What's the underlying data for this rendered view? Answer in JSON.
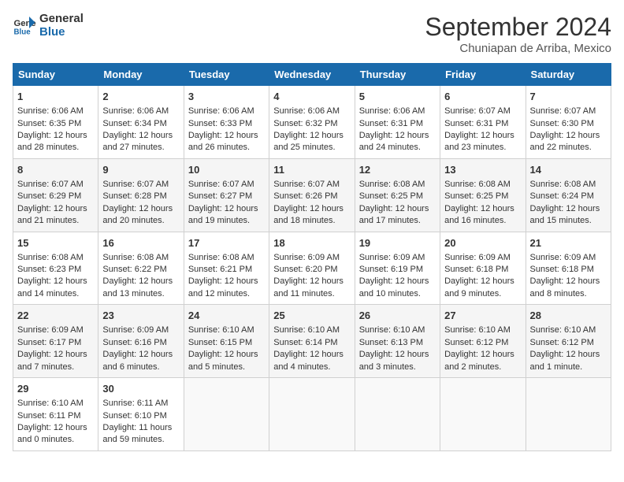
{
  "header": {
    "logo_line1": "General",
    "logo_line2": "Blue",
    "title": "September 2024",
    "subtitle": "Chuniapan de Arriba, Mexico"
  },
  "days_of_week": [
    "Sunday",
    "Monday",
    "Tuesday",
    "Wednesday",
    "Thursday",
    "Friday",
    "Saturday"
  ],
  "weeks": [
    [
      {
        "day": "1",
        "lines": [
          "Sunrise: 6:06 AM",
          "Sunset: 6:35 PM",
          "Daylight: 12 hours",
          "and 28 minutes."
        ]
      },
      {
        "day": "2",
        "lines": [
          "Sunrise: 6:06 AM",
          "Sunset: 6:34 PM",
          "Daylight: 12 hours",
          "and 27 minutes."
        ]
      },
      {
        "day": "3",
        "lines": [
          "Sunrise: 6:06 AM",
          "Sunset: 6:33 PM",
          "Daylight: 12 hours",
          "and 26 minutes."
        ]
      },
      {
        "day": "4",
        "lines": [
          "Sunrise: 6:06 AM",
          "Sunset: 6:32 PM",
          "Daylight: 12 hours",
          "and 25 minutes."
        ]
      },
      {
        "day": "5",
        "lines": [
          "Sunrise: 6:06 AM",
          "Sunset: 6:31 PM",
          "Daylight: 12 hours",
          "and 24 minutes."
        ]
      },
      {
        "day": "6",
        "lines": [
          "Sunrise: 6:07 AM",
          "Sunset: 6:31 PM",
          "Daylight: 12 hours",
          "and 23 minutes."
        ]
      },
      {
        "day": "7",
        "lines": [
          "Sunrise: 6:07 AM",
          "Sunset: 6:30 PM",
          "Daylight: 12 hours",
          "and 22 minutes."
        ]
      }
    ],
    [
      {
        "day": "8",
        "lines": [
          "Sunrise: 6:07 AM",
          "Sunset: 6:29 PM",
          "Daylight: 12 hours",
          "and 21 minutes."
        ]
      },
      {
        "day": "9",
        "lines": [
          "Sunrise: 6:07 AM",
          "Sunset: 6:28 PM",
          "Daylight: 12 hours",
          "and 20 minutes."
        ]
      },
      {
        "day": "10",
        "lines": [
          "Sunrise: 6:07 AM",
          "Sunset: 6:27 PM",
          "Daylight: 12 hours",
          "and 19 minutes."
        ]
      },
      {
        "day": "11",
        "lines": [
          "Sunrise: 6:07 AM",
          "Sunset: 6:26 PM",
          "Daylight: 12 hours",
          "and 18 minutes."
        ]
      },
      {
        "day": "12",
        "lines": [
          "Sunrise: 6:08 AM",
          "Sunset: 6:25 PM",
          "Daylight: 12 hours",
          "and 17 minutes."
        ]
      },
      {
        "day": "13",
        "lines": [
          "Sunrise: 6:08 AM",
          "Sunset: 6:25 PM",
          "Daylight: 12 hours",
          "and 16 minutes."
        ]
      },
      {
        "day": "14",
        "lines": [
          "Sunrise: 6:08 AM",
          "Sunset: 6:24 PM",
          "Daylight: 12 hours",
          "and 15 minutes."
        ]
      }
    ],
    [
      {
        "day": "15",
        "lines": [
          "Sunrise: 6:08 AM",
          "Sunset: 6:23 PM",
          "Daylight: 12 hours",
          "and 14 minutes."
        ]
      },
      {
        "day": "16",
        "lines": [
          "Sunrise: 6:08 AM",
          "Sunset: 6:22 PM",
          "Daylight: 12 hours",
          "and 13 minutes."
        ]
      },
      {
        "day": "17",
        "lines": [
          "Sunrise: 6:08 AM",
          "Sunset: 6:21 PM",
          "Daylight: 12 hours",
          "and 12 minutes."
        ]
      },
      {
        "day": "18",
        "lines": [
          "Sunrise: 6:09 AM",
          "Sunset: 6:20 PM",
          "Daylight: 12 hours",
          "and 11 minutes."
        ]
      },
      {
        "day": "19",
        "lines": [
          "Sunrise: 6:09 AM",
          "Sunset: 6:19 PM",
          "Daylight: 12 hours",
          "and 10 minutes."
        ]
      },
      {
        "day": "20",
        "lines": [
          "Sunrise: 6:09 AM",
          "Sunset: 6:18 PM",
          "Daylight: 12 hours",
          "and 9 minutes."
        ]
      },
      {
        "day": "21",
        "lines": [
          "Sunrise: 6:09 AM",
          "Sunset: 6:18 PM",
          "Daylight: 12 hours",
          "and 8 minutes."
        ]
      }
    ],
    [
      {
        "day": "22",
        "lines": [
          "Sunrise: 6:09 AM",
          "Sunset: 6:17 PM",
          "Daylight: 12 hours",
          "and 7 minutes."
        ]
      },
      {
        "day": "23",
        "lines": [
          "Sunrise: 6:09 AM",
          "Sunset: 6:16 PM",
          "Daylight: 12 hours",
          "and 6 minutes."
        ]
      },
      {
        "day": "24",
        "lines": [
          "Sunrise: 6:10 AM",
          "Sunset: 6:15 PM",
          "Daylight: 12 hours",
          "and 5 minutes."
        ]
      },
      {
        "day": "25",
        "lines": [
          "Sunrise: 6:10 AM",
          "Sunset: 6:14 PM",
          "Daylight: 12 hours",
          "and 4 minutes."
        ]
      },
      {
        "day": "26",
        "lines": [
          "Sunrise: 6:10 AM",
          "Sunset: 6:13 PM",
          "Daylight: 12 hours",
          "and 3 minutes."
        ]
      },
      {
        "day": "27",
        "lines": [
          "Sunrise: 6:10 AM",
          "Sunset: 6:12 PM",
          "Daylight: 12 hours",
          "and 2 minutes."
        ]
      },
      {
        "day": "28",
        "lines": [
          "Sunrise: 6:10 AM",
          "Sunset: 6:12 PM",
          "Daylight: 12 hours",
          "and 1 minute."
        ]
      }
    ],
    [
      {
        "day": "29",
        "lines": [
          "Sunrise: 6:10 AM",
          "Sunset: 6:11 PM",
          "Daylight: 12 hours",
          "and 0 minutes."
        ]
      },
      {
        "day": "30",
        "lines": [
          "Sunrise: 6:11 AM",
          "Sunset: 6:10 PM",
          "Daylight: 11 hours",
          "and 59 minutes."
        ]
      },
      {
        "day": "",
        "lines": []
      },
      {
        "day": "",
        "lines": []
      },
      {
        "day": "",
        "lines": []
      },
      {
        "day": "",
        "lines": []
      },
      {
        "day": "",
        "lines": []
      }
    ]
  ]
}
